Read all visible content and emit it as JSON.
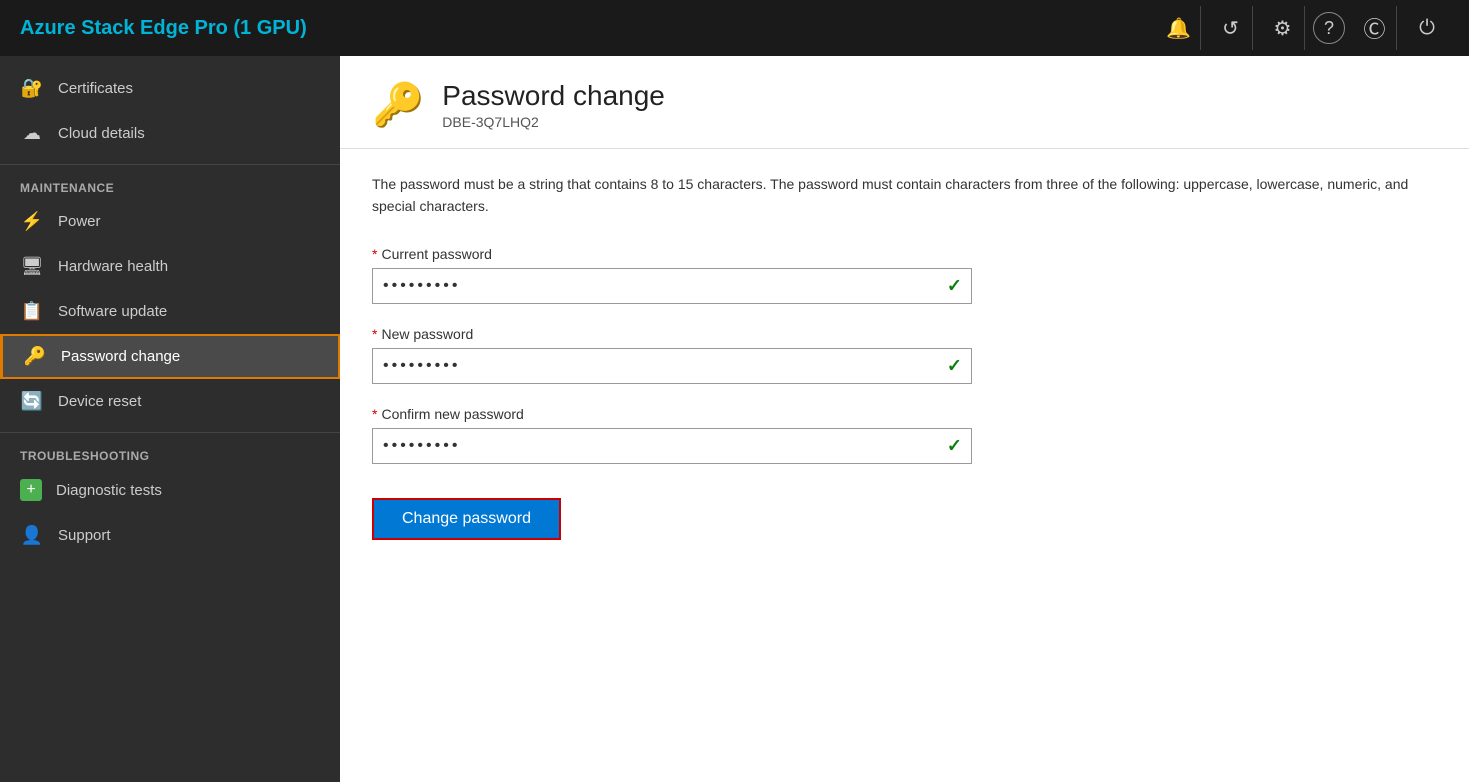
{
  "topbar": {
    "title": "Azure Stack Edge Pro (1 GPU)",
    "icons": [
      {
        "name": "bell-icon",
        "symbol": "🔔"
      },
      {
        "name": "refresh-icon",
        "symbol": "↺"
      },
      {
        "name": "settings-icon",
        "symbol": "⚙"
      },
      {
        "name": "help-icon",
        "symbol": "?"
      },
      {
        "name": "copyright-icon",
        "symbol": "Ⓒ"
      },
      {
        "name": "power-icon",
        "symbol": "⏻"
      }
    ]
  },
  "sidebar": {
    "top_items": [
      {
        "id": "certificates",
        "label": "Certificates",
        "icon": "🔐"
      },
      {
        "id": "cloud-details",
        "label": "Cloud details",
        "icon": "☁"
      }
    ],
    "maintenance_section": "MAINTENANCE",
    "maintenance_items": [
      {
        "id": "power",
        "label": "Power",
        "icon": "⚡"
      },
      {
        "id": "hardware-health",
        "label": "Hardware health",
        "icon": "🖥"
      },
      {
        "id": "software-update",
        "label": "Software update",
        "icon": "📋"
      },
      {
        "id": "password-change",
        "label": "Password change",
        "icon": "🔑",
        "active": true
      },
      {
        "id": "device-reset",
        "label": "Device reset",
        "icon": "🔄"
      }
    ],
    "troubleshooting_section": "TROUBLESHOOTING",
    "troubleshooting_items": [
      {
        "id": "diagnostic-tests",
        "label": "Diagnostic tests",
        "icon": "➕"
      },
      {
        "id": "support",
        "label": "Support",
        "icon": "👤"
      }
    ]
  },
  "page": {
    "icon": "🔑",
    "title": "Password change",
    "subtitle": "DBE-3Q7LHQ2",
    "description": "The password must be a string that contains 8 to 15 characters. The password must contain characters from three of the following: uppercase, lowercase, numeric, and special characters.",
    "fields": [
      {
        "id": "current-password",
        "label": "Current password",
        "required": true,
        "value": "••••••••",
        "valid": true
      },
      {
        "id": "new-password",
        "label": "New password",
        "required": true,
        "value": "••••••••",
        "valid": true
      },
      {
        "id": "confirm-password",
        "label": "Confirm new password",
        "required": true,
        "value": "••••••••",
        "valid": true
      }
    ],
    "submit_button": "Change password"
  }
}
